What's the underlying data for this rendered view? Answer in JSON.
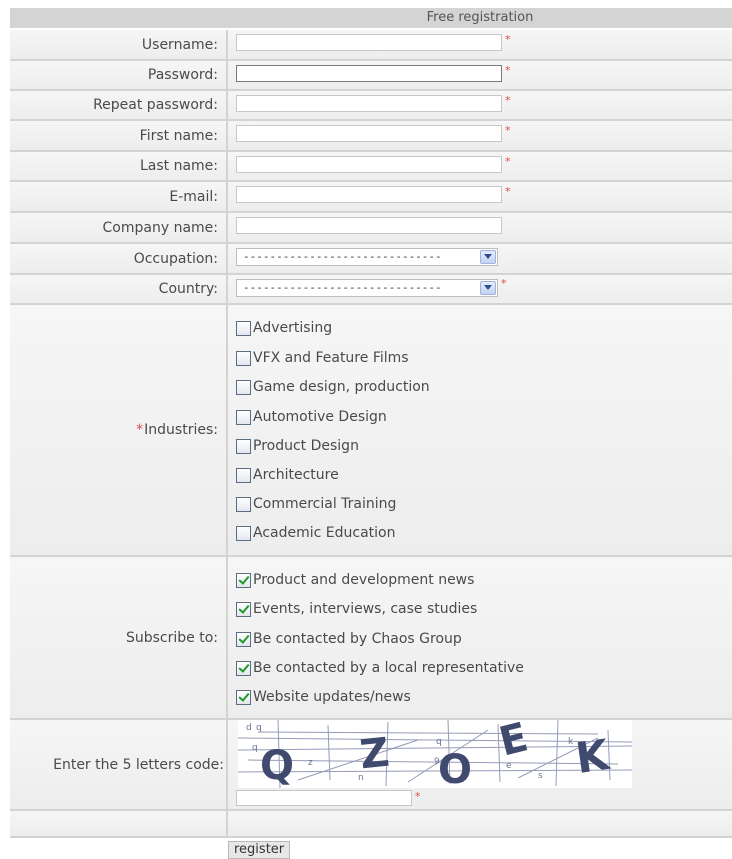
{
  "form": {
    "title": "Free registration",
    "required_mark": "*",
    "fields": {
      "username": {
        "label": "Username:",
        "value": ""
      },
      "password": {
        "label": "Password:",
        "value": ""
      },
      "repeat_password": {
        "label": "Repeat password:",
        "value": ""
      },
      "first_name": {
        "label": "First name:",
        "value": ""
      },
      "last_name": {
        "label": "Last name:",
        "value": ""
      },
      "email": {
        "label": "E-mail:",
        "value": ""
      },
      "company_name": {
        "label": "Company name:",
        "value": ""
      },
      "occupation": {
        "label": "Occupation:",
        "selected": "------------------------------"
      },
      "country": {
        "label": "Country:",
        "selected": "------------------------------"
      }
    },
    "industries": {
      "label": "Industries:",
      "options": [
        {
          "label": "Advertising",
          "checked": false
        },
        {
          "label": "VFX and Feature Films",
          "checked": false
        },
        {
          "label": "Game design, production",
          "checked": false
        },
        {
          "label": "Automotive Design",
          "checked": false
        },
        {
          "label": "Product Design",
          "checked": false
        },
        {
          "label": "Architecture",
          "checked": false
        },
        {
          "label": "Commercial Training",
          "checked": false
        },
        {
          "label": "Academic Education",
          "checked": false
        }
      ]
    },
    "subscribe": {
      "label": "Subscribe to:",
      "options": [
        {
          "label": "Product and development news",
          "checked": true
        },
        {
          "label": "Events, interviews, case studies",
          "checked": true
        },
        {
          "label": "Be contacted by Chaos Group",
          "checked": true
        },
        {
          "label": "Be contacted by a local representative",
          "checked": true
        },
        {
          "label": "Website updates/news",
          "checked": true
        }
      ]
    },
    "captcha": {
      "label": "Enter the 5 letters code:",
      "letters": [
        "Q",
        "Z",
        "O",
        "E",
        "K"
      ],
      "value": ""
    },
    "register_label": "register"
  },
  "colors": {
    "required": "#e04a4a",
    "check": "#1e9a2a",
    "captcha_letters": "#3f4a6e"
  }
}
